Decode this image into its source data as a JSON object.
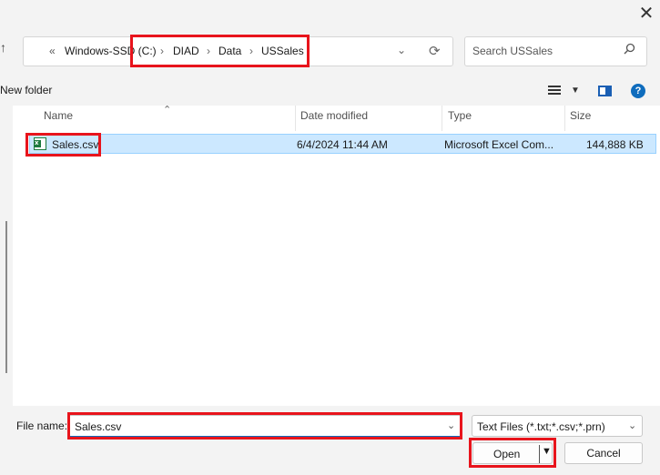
{
  "window": {
    "close_glyph": "✕"
  },
  "nav": {
    "up_glyph": "↑",
    "overflow_glyph": "«",
    "breadcrumb": [
      "Windows-SSD (C:)",
      "DIAD",
      "Data",
      "USSales"
    ],
    "separator_glyph": "›",
    "dropdown_glyph": "⌄",
    "refresh_glyph": "⟳"
  },
  "search": {
    "placeholder": "Search USSales",
    "icon": "search-icon"
  },
  "toolbar": {
    "new_folder_label": "New folder",
    "view_icon": "list-view-icon",
    "pane_icon": "preview-pane-icon",
    "help_label": "?"
  },
  "file_list": {
    "columns": [
      "Name",
      "Date modified",
      "Type",
      "Size"
    ],
    "rows": [
      {
        "name": "Sales.csv",
        "date_modified": "6/4/2024 11:44 AM",
        "type": "Microsoft Excel Com...",
        "size": "144,888 KB",
        "icon": "excel-file-icon",
        "selected": true
      }
    ]
  },
  "footer": {
    "file_name_label": "File name:",
    "file_name_value": "Sales.csv",
    "file_type_value": "Text Files (*.txt;*.csv;*.prn)",
    "open_label": "Open",
    "cancel_label": "Cancel"
  },
  "colors": {
    "highlight": "#e8141c",
    "selection": "#cce8ff",
    "accent": "#0f6cbd"
  }
}
